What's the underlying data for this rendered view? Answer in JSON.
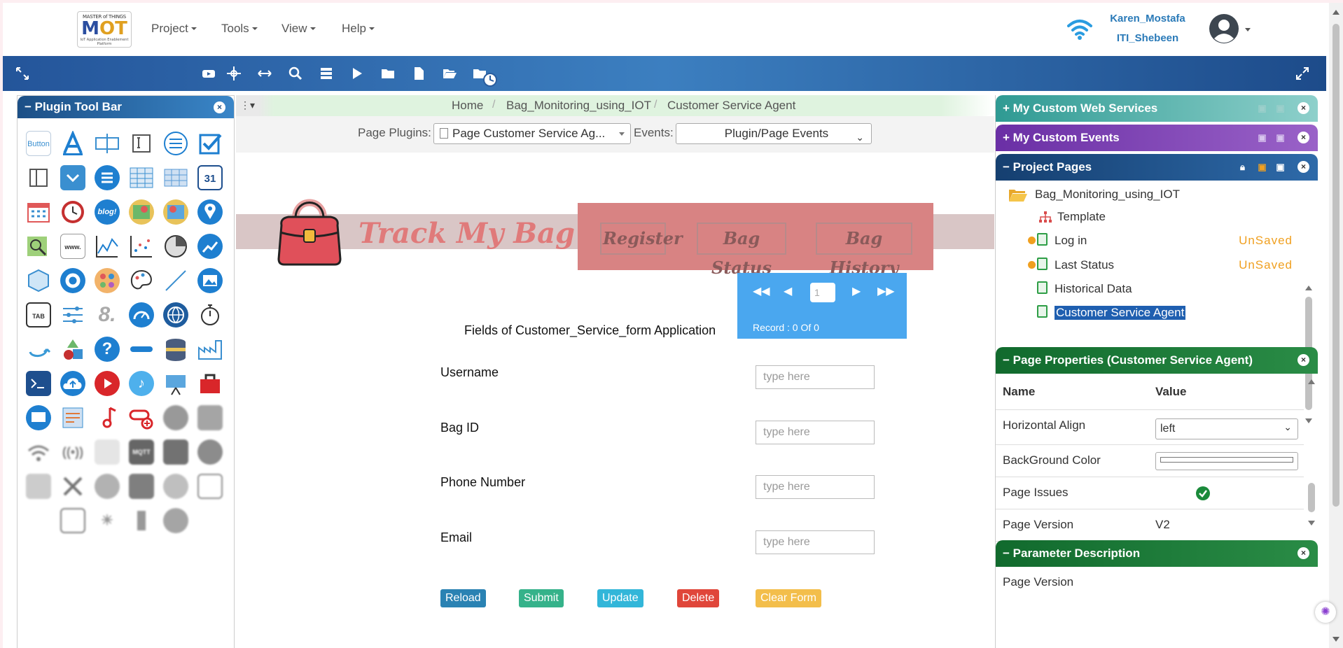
{
  "header": {
    "logo": {
      "line1": "MASTER of THINGS",
      "line2a": "M",
      "line2b": "OT",
      "line3": "IoT Application Enablement Platform"
    },
    "menus": [
      "Project",
      "Tools",
      "View",
      "Help"
    ],
    "user": {
      "name": "Karen_Mostafa",
      "org": "ITI_Shebeen"
    }
  },
  "plugin_toolbar": {
    "title": "Plugin Tool Bar",
    "close": "×",
    "first_icon_label": "Button",
    "tab_label": "TAB",
    "blog_label": "blog!",
    "calendar_day": "31"
  },
  "breadcrumb": {
    "items": [
      "Home",
      "Bag_Monitoring_using_IOT",
      "Customer Service Agent"
    ]
  },
  "page_plugins": {
    "label": "Page Plugins:",
    "selected": "Page Customer Service Ag...",
    "events_label": "Events:",
    "events_selected": "Plugin/Page Events"
  },
  "app": {
    "brand": "Track My Bag",
    "nav": [
      "Register",
      "Bag Status",
      "Bag History"
    ],
    "record": {
      "page": "1",
      "text": "Record : 0 Of 0"
    },
    "form_title": "Fields of Customer_Service_form Application",
    "fields": [
      {
        "label": "Username",
        "placeholder": "type here"
      },
      {
        "label": "Bag ID",
        "placeholder": "type here"
      },
      {
        "label": "Phone Number",
        "placeholder": "type here"
      },
      {
        "label": "Email",
        "placeholder": "type here"
      }
    ],
    "buttons": [
      {
        "label": "Reload",
        "color": "#2a82b3"
      },
      {
        "label": "Submit",
        "color": "#35b28a"
      },
      {
        "label": "Update",
        "color": "#32b6d9"
      },
      {
        "label": "Delete",
        "color": "#e0463a"
      },
      {
        "label": "Clear Form",
        "color": "#f3be4b"
      }
    ]
  },
  "right_panel": {
    "web_services": {
      "title": "My Custom Web Services",
      "color": "#3aa7a0"
    },
    "events": {
      "title": "My Custom Events",
      "color": "#7b3fb0"
    },
    "pages": {
      "title": "Project Pages",
      "color": "#1d4d86",
      "project": "Bag_Monitoring_using_IOT",
      "items": [
        {
          "name": "Template",
          "status": ""
        },
        {
          "name": "Log in",
          "status": "UnSaved"
        },
        {
          "name": "Last Status",
          "status": "UnSaved"
        },
        {
          "name": "Historical Data",
          "status": ""
        },
        {
          "name": "Customer Service Agent",
          "status": ""
        }
      ]
    },
    "properties": {
      "title": "Page Properties (Customer Service Agent)",
      "color": "#1a7a35",
      "col_name": "Name",
      "col_value": "Value",
      "rows": [
        {
          "name": "Horizontal Align",
          "value": "left"
        },
        {
          "name": "BackGround Color",
          "value": ""
        },
        {
          "name": "Page Issues",
          "value": ""
        },
        {
          "name": "Page Version",
          "value": "V2"
        }
      ]
    },
    "param": {
      "title": "Parameter Description",
      "color": "#1a7a35",
      "text": "Page Version"
    }
  }
}
